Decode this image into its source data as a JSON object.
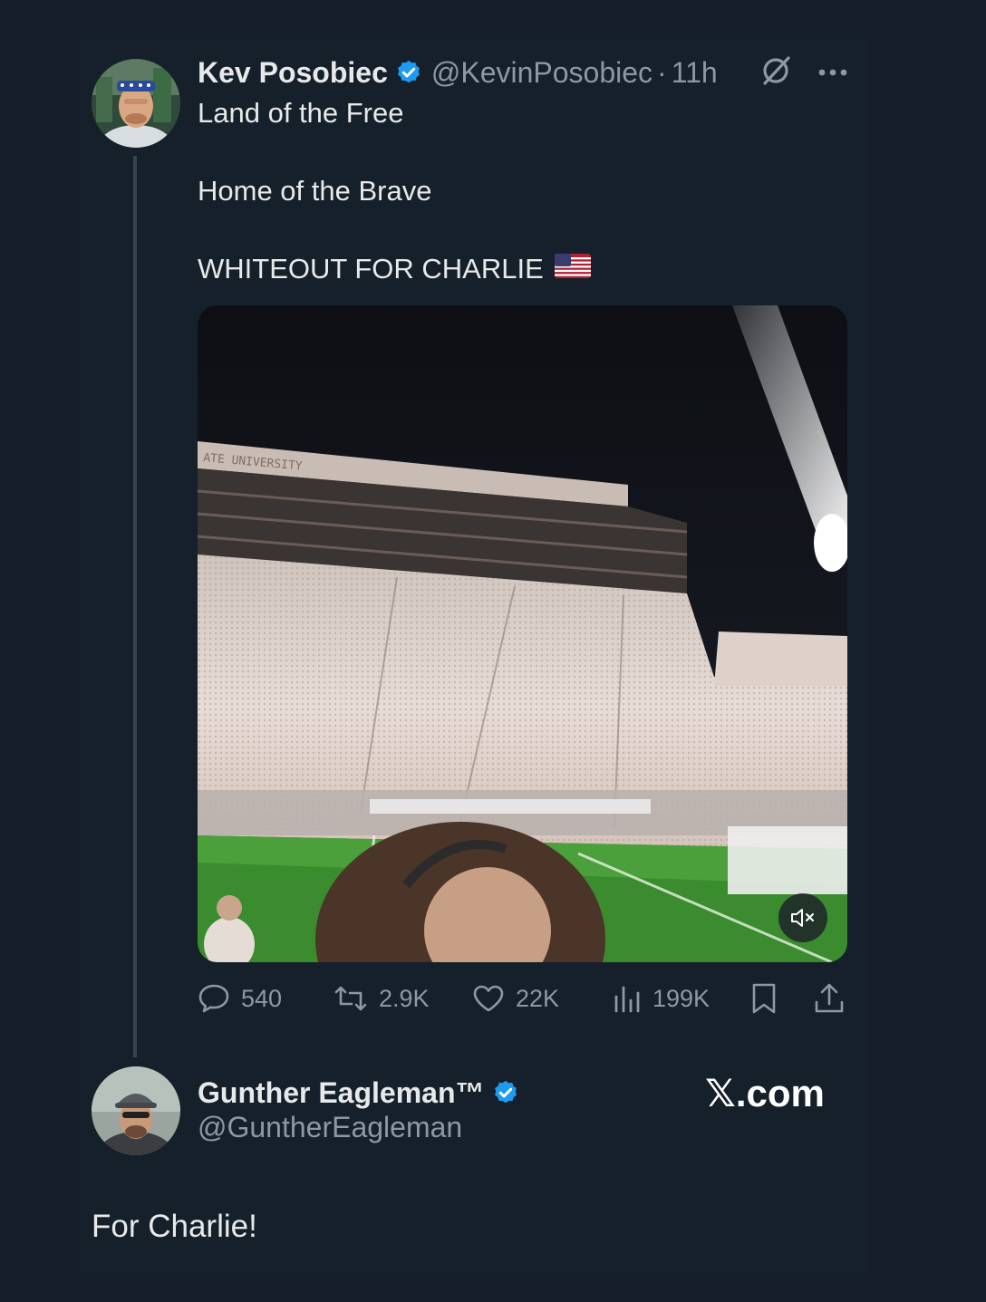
{
  "post": {
    "author": {
      "display_name": "Kev Posobiec",
      "handle": "@KevinPosobiec",
      "separator": "·",
      "time": "11h",
      "verified": true
    },
    "text_lines": [
      "Land of the Free",
      "Home of the Brave",
      "WHITEOUT FOR CHARLIE"
    ],
    "text_emoji": "us-flag",
    "media": {
      "type": "video",
      "muted": true,
      "stadium_sign_text": "ATE UNIVERSITY"
    },
    "stats": {
      "replies": "540",
      "reposts": "2.9K",
      "likes": "22K",
      "views": "199K"
    }
  },
  "reply": {
    "author": {
      "display_name": "Gunther Eagleman™",
      "handle": "@GuntherEagleman",
      "verified": true
    },
    "text": "For Charlie!"
  },
  "watermark": "𝕏.com",
  "colors": {
    "background": "#15202b",
    "text_primary": "#e7e9ea",
    "text_secondary": "#8b98a5",
    "verified_blue": "#1d9bf0",
    "thread_line": "#38444d"
  }
}
